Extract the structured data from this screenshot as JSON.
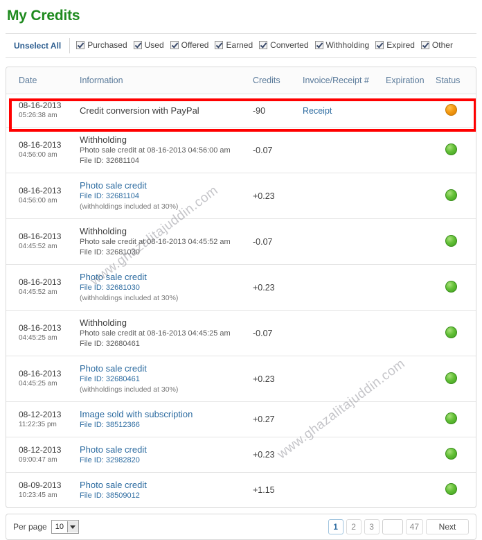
{
  "page": {
    "title": "My Credits",
    "watermark": "www.ghazalitajuddin.com"
  },
  "filters": {
    "unselect_all_label": "Unselect All",
    "items": [
      {
        "label": "Purchased",
        "checked": true
      },
      {
        "label": "Used",
        "checked": true
      },
      {
        "label": "Offered",
        "checked": true
      },
      {
        "label": "Earned",
        "checked": true
      },
      {
        "label": "Converted",
        "checked": true
      },
      {
        "label": "Withholding",
        "checked": true
      },
      {
        "label": "Expired",
        "checked": true
      },
      {
        "label": "Other",
        "checked": true
      }
    ]
  },
  "table": {
    "columns": {
      "date": "Date",
      "information": "Information",
      "credits": "Credits",
      "invoice": "Invoice/Receipt #",
      "expiration": "Expiration",
      "status": "Status"
    },
    "rows": [
      {
        "date": "08-16-2013",
        "time": "05:26:38 am",
        "info_title": "Credit conversion with PayPal",
        "info_title_link": false,
        "info_sub": "",
        "info_note": "",
        "credits": "-90",
        "invoice": "Receipt",
        "expiration": "",
        "status": "orange",
        "highlighted": true
      },
      {
        "date": "08-16-2013",
        "time": "04:56:00 am",
        "info_title": "Withholding",
        "info_title_link": false,
        "info_sub": "Photo sale credit at 08-16-2013 04:56:00 am",
        "info_sub2": "File ID: 32681104",
        "info_note": "",
        "credits": "-0.07",
        "invoice": "",
        "expiration": "",
        "status": "green",
        "highlighted": false
      },
      {
        "date": "08-16-2013",
        "time": "04:56:00 am",
        "info_title": "Photo sale credit",
        "info_title_link": true,
        "info_sub": "File ID: 32681104",
        "info_sub_link": true,
        "info_note": "(withholdings included at 30%)",
        "credits": "+0.23",
        "invoice": "",
        "expiration": "",
        "status": "green",
        "highlighted": false
      },
      {
        "date": "08-16-2013",
        "time": "04:45:52 am",
        "info_title": "Withholding",
        "info_title_link": false,
        "info_sub": "Photo sale credit at 08-16-2013 04:45:52 am",
        "info_sub2": "File ID: 32681030",
        "info_note": "",
        "credits": "-0.07",
        "invoice": "",
        "expiration": "",
        "status": "green",
        "highlighted": false
      },
      {
        "date": "08-16-2013",
        "time": "04:45:52 am",
        "info_title": "Photo sale credit",
        "info_title_link": true,
        "info_sub": "File ID: 32681030",
        "info_sub_link": true,
        "info_note": "(withholdings included at 30%)",
        "credits": "+0.23",
        "invoice": "",
        "expiration": "",
        "status": "green",
        "highlighted": false
      },
      {
        "date": "08-16-2013",
        "time": "04:45:25 am",
        "info_title": "Withholding",
        "info_title_link": false,
        "info_sub": "Photo sale credit at 08-16-2013 04:45:25 am",
        "info_sub2": "File ID: 32680461",
        "info_note": "",
        "credits": "-0.07",
        "invoice": "",
        "expiration": "",
        "status": "green",
        "highlighted": false
      },
      {
        "date": "08-16-2013",
        "time": "04:45:25 am",
        "info_title": "Photo sale credit",
        "info_title_link": true,
        "info_sub": "File ID: 32680461",
        "info_sub_link": true,
        "info_note": "(withholdings included at 30%)",
        "credits": "+0.23",
        "invoice": "",
        "expiration": "",
        "status": "green",
        "highlighted": false
      },
      {
        "date": "08-12-2013",
        "time": "11:22:35 pm",
        "info_title": "Image sold with subscription",
        "info_title_link": true,
        "info_sub": "File ID: 38512366",
        "info_sub_link": true,
        "info_note": "",
        "credits": "+0.27",
        "invoice": "",
        "expiration": "",
        "status": "green",
        "highlighted": false
      },
      {
        "date": "08-12-2013",
        "time": "09:00:47 am",
        "info_title": "Photo sale credit",
        "info_title_link": true,
        "info_sub": "File ID: 32982820",
        "info_sub_link": true,
        "info_note": "",
        "credits": "+0.23",
        "invoice": "",
        "expiration": "",
        "status": "green",
        "highlighted": false
      },
      {
        "date": "08-09-2013",
        "time": "10:23:45 am",
        "info_title": "Photo sale credit",
        "info_title_link": true,
        "info_sub": "File ID: 38509012",
        "info_sub_link": true,
        "info_note": "",
        "credits": "+1.15",
        "invoice": "",
        "expiration": "",
        "status": "green",
        "highlighted": false
      }
    ]
  },
  "footer": {
    "per_page_label": "Per page",
    "per_page_value": "10",
    "pages": [
      "1",
      "2",
      "3"
    ],
    "blank_page": "",
    "last_page": "47",
    "next_label": "Next",
    "current_page": "1"
  },
  "colors": {
    "title_green": "#1e8a1e",
    "link_blue": "#2c6ba0",
    "status_green": "#63c037",
    "status_orange": "#f49a12",
    "highlight_red": "#ff0000"
  }
}
